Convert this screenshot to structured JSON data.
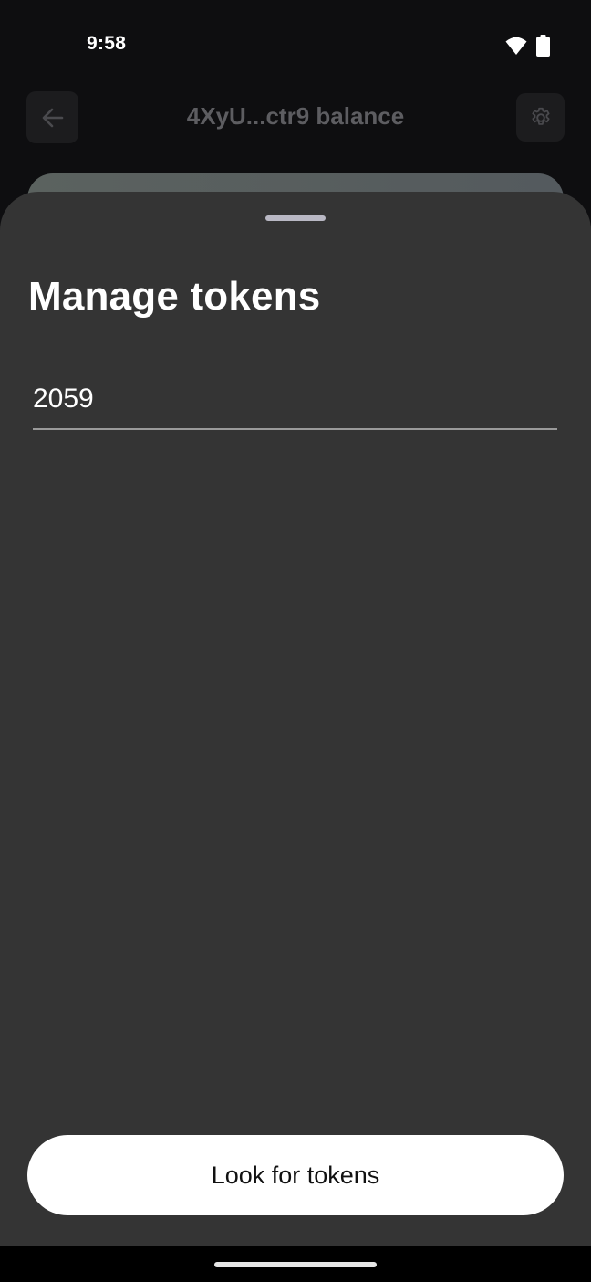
{
  "status_bar": {
    "time": "9:58",
    "icons": [
      "wifi-icon",
      "battery-icon"
    ]
  },
  "background": {
    "title": "4XyU...ctr9 balance",
    "back_icon": "arrow-left-icon",
    "settings_icon": "gear-icon"
  },
  "sheet": {
    "title": "Manage tokens",
    "input_value": "2059",
    "button_label": "Look for tokens"
  },
  "colors": {
    "sheet_background": "#343434",
    "app_background": "#0e0e10",
    "button_background": "#ffffff",
    "dimmed_text": "#5d5d61"
  }
}
